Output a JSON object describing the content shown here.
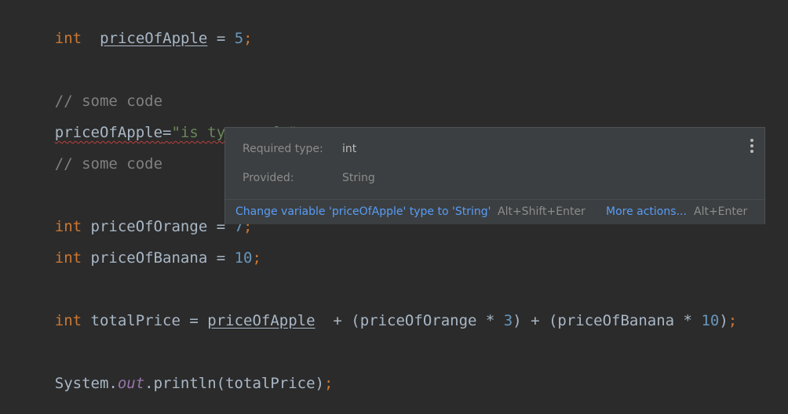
{
  "code": {
    "line1": {
      "kw": "int",
      "name": "priceOfApple",
      "op": " = ",
      "value": "5",
      "end": ";"
    },
    "line3": {
      "comment": "// some code"
    },
    "line4": {
      "name": "priceOfApple",
      "op": "=",
      "string": "\"is type safe\"",
      "end": ";"
    },
    "line5": {
      "comment": "// some code"
    },
    "line7": {
      "kw": "int",
      "name": "priceOfOrange",
      "op": " = ",
      "value": "7",
      "end": ";"
    },
    "line8": {
      "kw": "int",
      "name": "priceOfBanana",
      "op": " = ",
      "value": "10",
      "end": ";"
    },
    "line10": {
      "kw": "int",
      "name": "totalPrice",
      "op": " = ",
      "ref1": "priceOfApple",
      "part2": "  + (priceOfOrange * ",
      "num1": "3",
      "part3": ") + (priceOfBanana * ",
      "num2": "10",
      "part4": ")",
      "end": ";"
    },
    "line12": {
      "obj": "System.",
      "field": "out",
      "call": ".println(totalPrice)",
      "end": ";"
    }
  },
  "popup": {
    "required_label": "Required type:",
    "required_value": "int",
    "provided_label": "Provided:",
    "provided_value": "String",
    "fix_action": "Change variable 'priceOfApple' type to 'String'",
    "fix_shortcut": "Alt+Shift+Enter",
    "more_action": "More actions...",
    "more_shortcut": "Alt+Enter",
    "menu_icon": "more-vertical-icon"
  },
  "colors": {
    "background": "#2b2b2b",
    "keyword": "#cc7832",
    "number": "#6897bb",
    "string": "#6a8759",
    "comment": "#808080",
    "link": "#589df6",
    "error": "#bc3f3c"
  }
}
